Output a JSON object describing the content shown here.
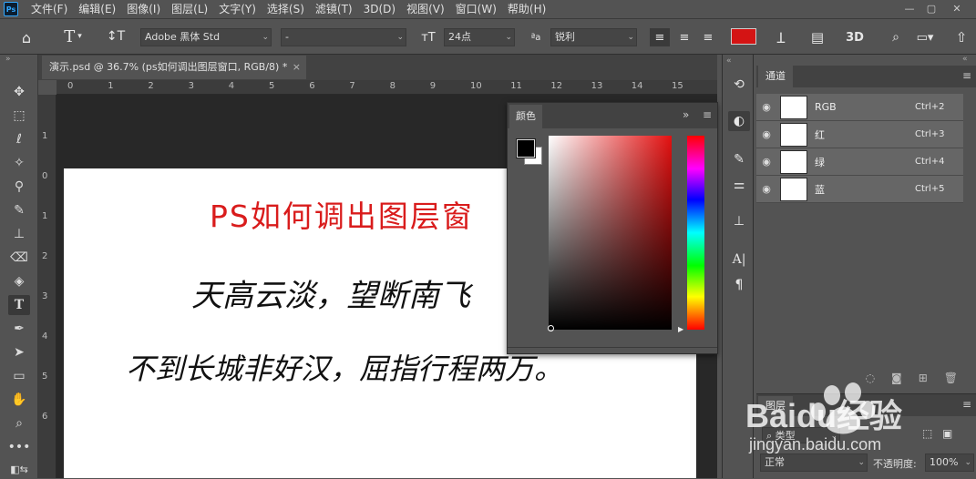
{
  "app": {
    "logo": "Ps"
  },
  "menu": [
    "文件(F)",
    "编辑(E)",
    "图像(I)",
    "图层(L)",
    "文字(Y)",
    "选择(S)",
    "滤镜(T)",
    "3D(D)",
    "视图(V)",
    "窗口(W)",
    "帮助(H)"
  ],
  "options": {
    "font_family": "Adobe 黑体 Std",
    "font_style": "-",
    "font_size": "24点",
    "aa_label": "ªa",
    "antialias": "锐利",
    "color_swatch": "#d41414"
  },
  "tab": {
    "title": "演示.psd @ 36.7% (ps如何调出图层窗口, RGB/8) *",
    "close": "×"
  },
  "ruler": {
    "top": [
      "0",
      "1",
      "2",
      "3",
      "4",
      "5",
      "6",
      "7",
      "8",
      "9",
      "10",
      "11",
      "12",
      "13",
      "14",
      "15"
    ],
    "left": [
      "1",
      "0",
      "1",
      "2",
      "3",
      "4",
      "5",
      "6"
    ]
  },
  "document": {
    "title": "PS如何调出图层窗",
    "line1": "天高云淡，望断南飞",
    "line2": "不到长城非好汉，屈指行程两万。"
  },
  "color_panel": {
    "tab": "颜色",
    "expand": "»",
    "menu": "≡",
    "fg": "#000000",
    "bg": "#ffffff"
  },
  "channels": {
    "tab": "通道",
    "rows": [
      {
        "name": "RGB",
        "key": "Ctrl+2"
      },
      {
        "name": "红",
        "key": "Ctrl+3"
      },
      {
        "name": "绿",
        "key": "Ctrl+4"
      },
      {
        "name": "蓝",
        "key": "Ctrl+5"
      }
    ]
  },
  "layers": {
    "tab": "图层",
    "filter": "类型",
    "blend_mode": "正常",
    "opacity_label": "不透明度:",
    "opacity": "100%"
  },
  "watermark": {
    "brand": "Baidu经验",
    "url": "jingyan.baidu.com"
  }
}
